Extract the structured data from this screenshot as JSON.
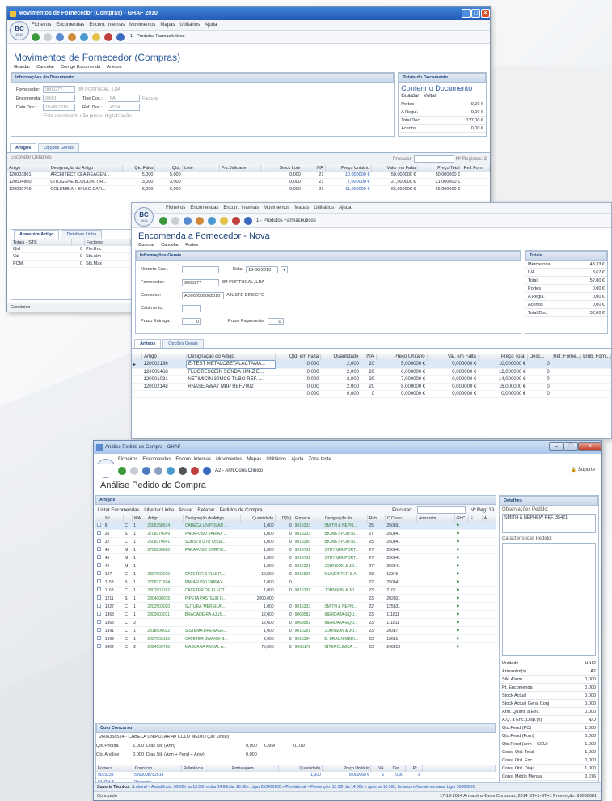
{
  "w1": {
    "title": "Movimentos de Fornecedor (Compras) - GHAF 2010",
    "menu": [
      "Ficheiros",
      "Encomendas",
      "Encom. Internas",
      "Movimentos",
      "Mapas",
      "Utilitários",
      "Ajuda"
    ],
    "farm": "1 - Produtos Farmacêuticos",
    "heading": "Movimentos de Fornecedor (Compras)",
    "actions": [
      "Guardar",
      "Cancelar",
      "Corrige Encomenda",
      "Anexos"
    ],
    "doc_section": "Informações do Documento",
    "fornecedor_label": "Fornecedor:",
    "fornecedor_code": "9000277",
    "fornecedor_name": "3M PORTUGAL, LDA",
    "encomenda_label": "Encomenda:",
    "encomenda": "09/01",
    "tipo_doc_label": "Tipo Doc.:",
    "tipo_doc": "FA",
    "tipo_doc_desc": "Factura",
    "data_doc_label": "Data Doc.:",
    "data_doc": "19-08-2010",
    "ref_doc_label": "Ref. Doc.:",
    "ref_doc": "4574",
    "no_digital": "Este documento não possui digitalização.",
    "totals_section": "Totais do Documento",
    "conferir": "Conferir o Documento",
    "totals_actions": [
      "Guardar",
      "Voltar"
    ],
    "totals": [
      {
        "k": "Portes",
        "v": "0,00 €"
      },
      {
        "k": "A Regul.",
        "v": "0,00 €"
      },
      {
        "k": "Total Doc.",
        "v": "137,00 €"
      },
      {
        "k": "Acertos",
        "v": "0,00 €"
      }
    ],
    "tabs": [
      "Artigos",
      "Opções Gerais"
    ],
    "filter": "Esconder Detalhes",
    "search_label": "Procurar:",
    "registos": "Nº Registos: 3",
    "cols": [
      "Artigo",
      "Designação do Artigo",
      "Qtd.Falta",
      "Qtd.",
      "Lote",
      "Prz.Validade",
      "Stock Lote",
      "IVA",
      "Preço Unitário",
      "Valor em Falta",
      "Preço Total",
      "Ref. Forn"
    ],
    "rows": [
      [
        "120003801",
        "ARCHITECT CEA REAGEN...",
        "5,000",
        "5,000",
        "",
        "",
        "0,000",
        "21",
        "10,000000 €",
        "50,000000 €",
        "50,000000 €",
        ""
      ],
      [
        "120004800",
        "CITOGENE BLOOD KIT R...",
        "3,000",
        "3,000",
        "",
        "",
        "0,000",
        "21",
        "7,000000 €",
        "21,000000 €",
        "21,000000 €",
        ""
      ],
      [
        "120000769",
        "COLUMBIA + 5%SG CAR...",
        "6,000",
        "6,000",
        "",
        "",
        "0,000",
        "21",
        "11,000000 €",
        "66,000000 €",
        "66,000000 €",
        ""
      ]
    ],
    "bottom_tabs": [
      "Armazém/Artigo",
      "Detalhes Linha"
    ],
    "totals_stk_head": "Totais - STK",
    "factores_head": "Factores",
    "stk": [
      {
        "k": "Qtd",
        "v": "0",
        "f": "Pto.Enc"
      },
      {
        "k": "Val",
        "v": "0",
        "f": "Stk.Alm"
      },
      {
        "k": "PCM",
        "v": "0",
        "f": "Stk.Max"
      }
    ],
    "status": "Concluido"
  },
  "w2": {
    "menu": [
      "Ficheiros",
      "Encomendas",
      "Encom. Internas",
      "Movimentos",
      "Mapas",
      "Utilitários",
      "Ajuda"
    ],
    "farm": "1 - Produtos Farmacêuticos",
    "heading": "Encomenda a Fornecedor - Nova",
    "actions": [
      "Guardar",
      "Cancelar",
      "Portes"
    ],
    "info_section": "Informações Gerais",
    "numero_label": "Número Enc.:",
    "numero": "",
    "data_label": "Data:",
    "data": "16-08-2010",
    "fornecedor_label": "Fornecedor:",
    "fornecedor_code": "9000277",
    "fornecedor_name": "3M PORTUGAL, LDA",
    "concurso_label": "Concurso:",
    "concurso_code": "AD000000002010",
    "concurso_name": "AJUSTE DIRECTO",
    "cabimento_label": "Cabimento:",
    "cabimento": "",
    "prazo_entrega_label": "Prazo Entrega:",
    "prazo_entrega": "0",
    "prazo_pag_label": "Prazo Pagamento:",
    "prazo_pag": "0",
    "totais_section": "Totais",
    "totais": [
      {
        "k": "Mercadoria",
        "v": "43,33 €"
      },
      {
        "k": "IVA",
        "v": "8,67 €"
      },
      {
        "k": "Total",
        "v": "52,00 €"
      },
      {
        "k": "Portes",
        "v": "0,00 €"
      },
      {
        "k": "A Regul.",
        "v": "0,00 €"
      },
      {
        "k": "Acertos",
        "v": "0,00 €"
      },
      {
        "k": "Total Doc.",
        "v": "52,00 €"
      }
    ],
    "tabs": [
      "Artigos",
      "Opções Gerais"
    ],
    "cols": [
      "Artigo",
      "Designação do Artigo",
      "Qtd. em Falta",
      "Quantidade",
      "IVA",
      "Preço Unitário",
      "Val. em Falta",
      "Preço Total",
      "Desc...",
      "Ref. Forne...",
      "Emb. Forn..."
    ],
    "rows": [
      [
        "120002136",
        "E-TEST METALOBETALACTAMA...",
        "0,000",
        "2,000",
        "20",
        "5,000000 €",
        "0,000000 €",
        "10,000000 €",
        "0",
        "",
        ""
      ],
      [
        "120005468",
        "FLUORESCEIN SONDA 1MKZ E...",
        "0,000",
        "2,000",
        "20",
        "6,000000 €",
        "0,000000 €",
        "12,000000 €",
        "0",
        "",
        ""
      ],
      [
        "120001031",
        "NETIMICIN 30MCG TUBO REF. ...",
        "0,000",
        "2,000",
        "20",
        "7,000000 €",
        "0,000000 €",
        "14,000000 €",
        "0",
        "",
        ""
      ],
      [
        "120002148",
        "RNASE AWAY MBP REF.7002",
        "0,000",
        "2,000",
        "20",
        "8,000000 €",
        "0,000000 €",
        "16,000000 €",
        "0",
        "",
        ""
      ],
      [
        "",
        "",
        "0,000",
        "0,000",
        "0",
        "0,000000 €",
        "0,000000 €",
        "0,000000 €",
        "0",
        "",
        ""
      ]
    ]
  },
  "w3": {
    "title": "Análise Pedido de Compra - GHAF",
    "menu": [
      "Ficheiros",
      "Encomendas",
      "Encom. Internas",
      "Movimentos",
      "Mapas",
      "Utilitários",
      "Ajuda",
      "Zona teste"
    ],
    "farm": "A2 - Arm.Cons.Clínico",
    "support": "Suporte",
    "heading": "Análise Pedido de Compra",
    "artigos_section": "Artigos",
    "detalhes_section": "Detalhes",
    "toolbar": [
      "Listar Encomendas",
      "Libertar Linha",
      "Anular",
      "Refazer",
      "Pedidos de Compra"
    ],
    "search_label": "Procurar:",
    "reg": "Nº Reg: 19",
    "cols": [
      "Nº ...",
      "",
      "N/A",
      "Artigo",
      "Designação do Artigo",
      "Quantidade",
      "D(%)",
      "Fornece...",
      "Designação do ...",
      "Rub...",
      "C.Custo",
      "Armazém",
      "GHC",
      "E...",
      "A"
    ],
    "rows": [
      [
        "6",
        "C",
        "1",
        "2606358514",
        "CABECA UNIPOLAR ...",
        "1,000",
        "0",
        "9015233",
        "SMITH & NEPH...",
        "25",
        "250891"
      ],
      [
        "26",
        "S",
        "1",
        "2708370049",
        "PARAFUSO VARIAX ...",
        "1,000",
        "0",
        "9015233",
        "BIOMET PORTU...",
        "27",
        "250841"
      ],
      [
        "32",
        "C",
        "1",
        "2608370641",
        "SUBSTITUTO OSSE...",
        "1,000",
        "0",
        "9015289",
        "BIOMET PORTU...",
        "25",
        "250841"
      ],
      [
        "45",
        "M",
        "1",
        "2708636620",
        "PARAFUSO CORTIC...",
        "1,000",
        "0",
        "9016732",
        "STRYKER PORT...",
        "27",
        "250841"
      ],
      [
        "45",
        "M",
        "1",
        "",
        "",
        "1,000",
        "0",
        "9016732",
        "STRYKER PORT...",
        "27",
        "250841"
      ],
      [
        "45",
        "M",
        "1",
        "",
        "",
        "1,000",
        "0",
        "9016291",
        "JOHNSON & JO...",
        "27",
        "250841"
      ],
      [
        "127",
        "C",
        "1",
        "2307003010",
        "CATETER 3 VIAS P/...",
        "10,000",
        "0",
        "9015526",
        "MUNDINTER S.A.",
        "23",
        "12345"
      ],
      [
        "1158",
        "S",
        "1",
        "2708371694",
        "PARAFUSO VARIAX ...",
        "1,000",
        "0",
        "",
        "",
        "27",
        "250841"
      ],
      [
        "1168",
        "C",
        "1",
        "2307003162",
        "CATETER DE ELECT...",
        "1,000",
        "0",
        "9016291",
        "JOHNSON & JO...",
        "23",
        "2102"
      ],
      [
        "1211",
        "S",
        "1",
        "2304000015",
        "PIPETA PASTEUR D...",
        "2000,000",
        "",
        "",
        "",
        "23",
        "202801"
      ],
      [
        "1327",
        "C",
        "1",
        "2202503020",
        "SUTURA 'MERSILA'...",
        "1,000",
        "0",
        "9015233",
        "SMITH & NEPH...",
        "22",
        "125831"
      ],
      [
        "1363",
        "C",
        "1",
        "2303003011",
        "BRACADEIRA AJUS...",
        "12,000",
        "0",
        "9069582",
        "IBERDATA-EQU...",
        "23",
        "111811"
      ],
      [
        "1363",
        "C",
        "2",
        "",
        "",
        "12,000",
        "0",
        "9069582",
        "IBERDATA-EQU...",
        "23",
        "111811"
      ],
      [
        "1391",
        "C",
        "1",
        "2318000022",
        "SISTEMA DRENAGE...",
        "1,000",
        "0",
        "9016291",
        "JOHNSON & JO...",
        "23",
        "20387"
      ],
      [
        "1399",
        "C",
        "1",
        "2307003120",
        "CATETER SWANG-G...",
        "2,000",
        "0",
        "9015384",
        "B. BRAUN MEDI...",
        "23",
        "13681"
      ],
      [
        "1402",
        "C",
        "2",
        "2324500780",
        "MASCARA FACIAL A...",
        "75,000",
        "0",
        "9005172",
        "INTERCLINICA ...",
        "23",
        "240813"
      ]
    ],
    "obs_label": "Observações Pedido:",
    "obs": "SMITH & NEPHEW REF. 35421",
    "carac_label": "Características Pedido:",
    "details": [
      {
        "k": "Unidade",
        "v": "UNID"
      },
      {
        "k": "Armazém(s)",
        "v": "A2"
      },
      {
        "k": "Stk. Alarm",
        "v": "0,000"
      },
      {
        "k": "Pt. Encomenda",
        "v": "0,000"
      },
      {
        "k": "Stock Actual",
        "v": "0,000"
      },
      {
        "k": "Stock Actual Geral Conj",
        "v": "0,000"
      },
      {
        "k": "Arm. Quant. a Enc.",
        "v": "0,000"
      },
      {
        "k": "A.Q. a Enc.(Disp.(n)",
        "v": "N/D"
      },
      {
        "k": "Qtd.Pend (PC)",
        "v": "1,000"
      },
      {
        "k": "Qtd.Pend (Forn)",
        "v": "0,000"
      },
      {
        "k": "Qtd.Pend (Arm + CCU)",
        "v": "1,000"
      },
      {
        "k": "Cons. Qtd. Total",
        "v": "1,000"
      },
      {
        "k": "Cons. Qtd. Enc",
        "v": "0,000"
      },
      {
        "k": "Cons. Qtd. Diaja",
        "v": "1,000"
      },
      {
        "k": "Cons. Médio Mensal",
        "v": "0,076"
      },
      {
        "k": "Dias Stk (Arm)",
        "v": "0,000"
      },
      {
        "k": "Dias Stk (Forn)",
        "v": "0,000"
      },
      {
        "k": "Dias Stk (Arm + Pend)",
        "v": "0,000"
      }
    ],
    "com_conc": "Com Concurso",
    "cc_title": "2606358514 - CABECA UNIPOLAR 40 COLO MEDIO (Un: UNID)",
    "cc_rows": [
      {
        "k": "Qtd.Pedida",
        "v": "1,000",
        "k2": "Dias Stk (Arm)",
        "v2": "0,000",
        "k3": "CMM",
        "v3": "0,019"
      },
      {
        "k": "Qtd.Análise",
        "v": "0,000",
        "k2": "Dias Stk (Arm + Pend + Anw)",
        "v2": "0,000"
      }
    ],
    "bot_cols": [
      "Forneca...",
      "Concurso",
      "Referência",
      "Embalagem",
      "Quantidade",
      "Preço Unitário",
      "IVA",
      "Des...",
      "Pr..."
    ],
    "bot_rows": [
      [
        "9015233",
        "5200008782514",
        "",
        "",
        "1,000",
        "8,000068 €",
        "6",
        "0,00",
        "8"
      ],
      [
        "SMITH &...",
        "Protocolo",
        "",
        "",
        "",
        "",
        "",
        "",
        ""
      ]
    ],
    "support_label": "Suporte Técnico:",
    "support_text": "»Laboral – Assistência: 09:00h às 13:00h e das 14:00h às 18:30h. Ligar 253400100 » Pós-laboral – Prevenção: 13:30h às 14:00h e após as 18:30h, feriados e fins-de-semana. Ligar 93080681",
    "status_left": "Concluído",
    "status_right": "17-10-2014   Armazéns-Bens Consumo; 2014   ST+1-ST+1   Prevenção: 93080681"
  }
}
